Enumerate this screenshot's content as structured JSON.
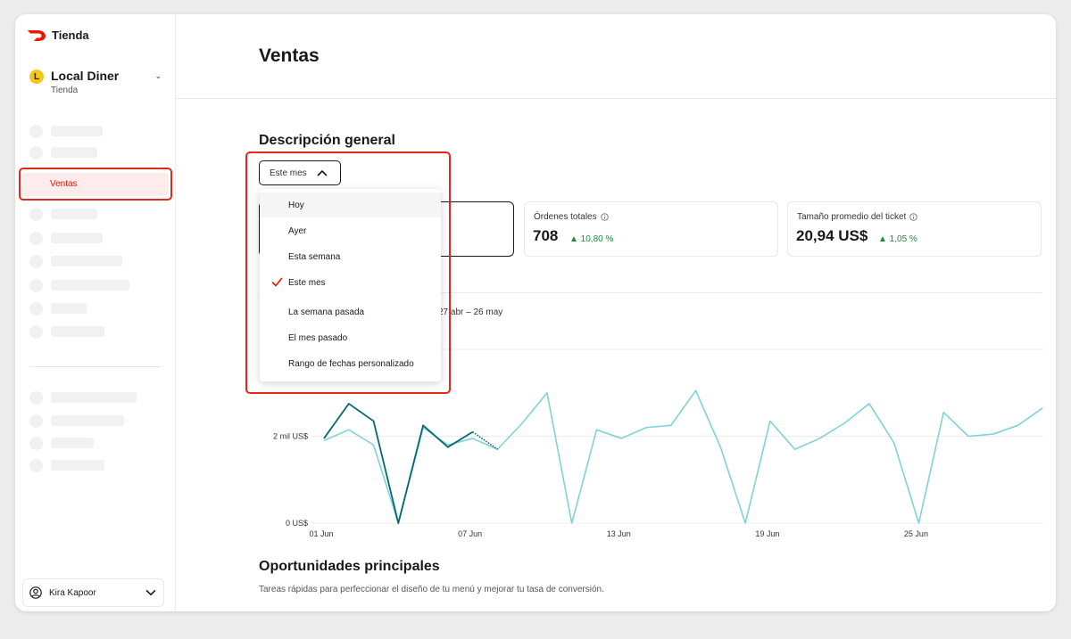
{
  "app": {
    "brand": "Tienda",
    "accent": "#eb1700",
    "store_name": "Local Diner",
    "store_initial": "L",
    "store_type": "Tienda"
  },
  "sidebar": {
    "active_item": "Ventas",
    "user_name": "Kira Kapoor"
  },
  "page": {
    "title": "Ventas",
    "section_title": "Descripción general",
    "range_selected": "Este mes"
  },
  "kpis": [
    {
      "label": "Órdenes totales",
      "value": "708",
      "change": "▲ 10,80 %"
    },
    {
      "label": "Tamaño promedio del ticket",
      "value": "20,94 US$",
      "change": "▲ 1,05 %"
    }
  ],
  "range_menu": {
    "options": [
      "Hoy",
      "Ayer",
      "Esta semana",
      "Este mes",
      "La semana pasada",
      "El mes pasado",
      "Rango de fechas personalizado"
    ],
    "selected_index": 3,
    "hover_index": 0
  },
  "chart": {
    "compare_range": "27 abr – 26 may"
  },
  "chart_data": {
    "type": "line",
    "x_ticks": [
      "01 Jun",
      "07 Jun",
      "13 Jun",
      "19 Jun",
      "25 Jun"
    ],
    "y_ticks": [
      "0 US$",
      "2 mil US$"
    ],
    "ylim": [
      0,
      4000
    ],
    "series": [
      {
        "color": "#006b72",
        "values": [
          1950,
          2750,
          2350,
          0,
          2250,
          1750,
          2100
        ]
      },
      {
        "color": "#7fd3d6",
        "values": [
          1900,
          2150,
          1800,
          0,
          2200,
          1800,
          1950,
          1700,
          2300,
          3000,
          0,
          2150,
          1950,
          2200,
          2250,
          3050,
          1750,
          0,
          2350,
          1700,
          1950,
          2300,
          2750,
          1850,
          0,
          2550,
          2000,
          2050,
          2250,
          2650
        ]
      }
    ],
    "grid": true,
    "legend": "none"
  },
  "opportunities": {
    "title": "Oportunidades principales",
    "subtitle": "Tareas rápidas para perfeccionar el diseño de tu menú y mejorar tu tasa de conversión."
  }
}
